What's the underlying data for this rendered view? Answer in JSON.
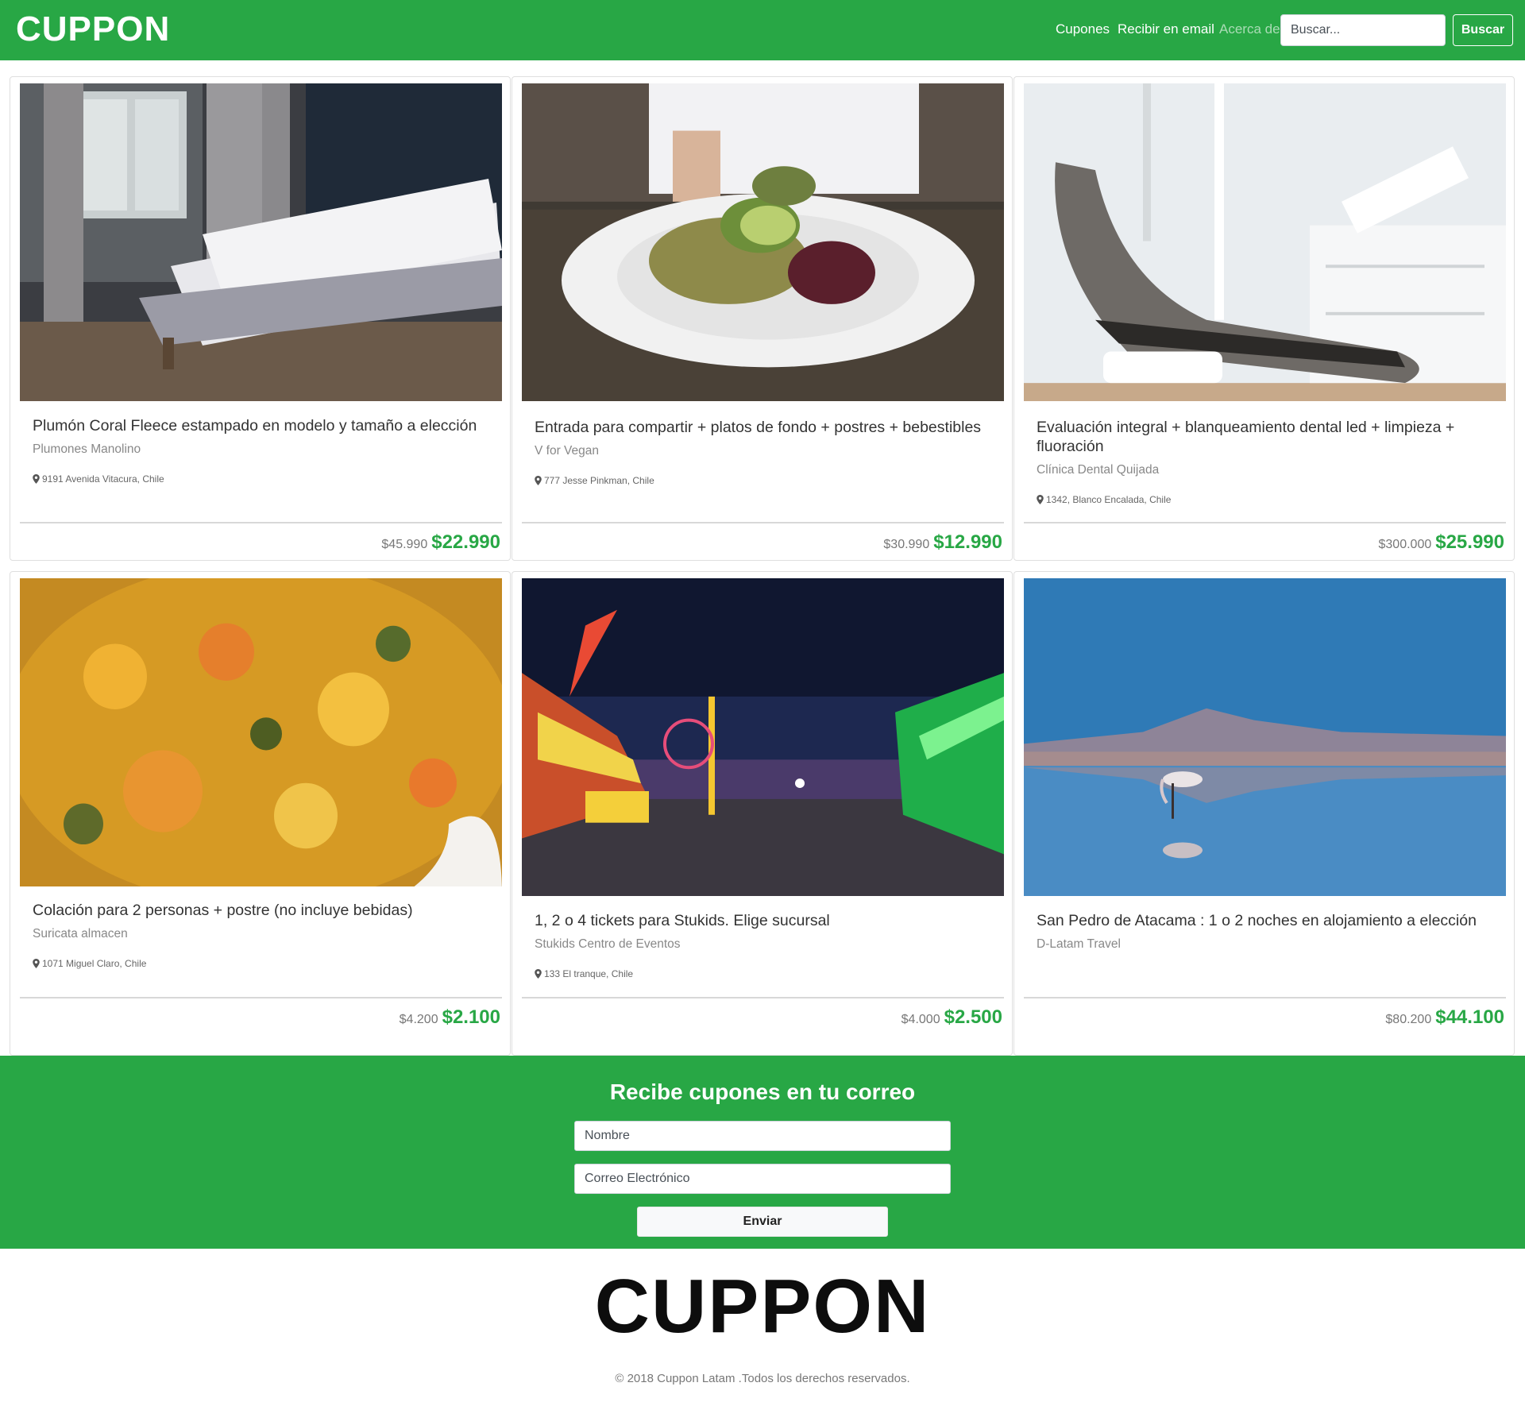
{
  "navbar": {
    "brand": "CUPPON",
    "links": [
      "Cupones",
      "Recibir en email",
      "Acerca de"
    ],
    "search_placeholder": "Buscar...",
    "search_button": "Buscar",
    "color": "#28a745"
  },
  "cards": [
    {
      "title": "Plumón Coral Fleece estampado en modelo y tamaño a elección",
      "vendor": "Plumones Manolino",
      "address": "9191 Avenida Vitacura, Chile",
      "price_old": "$45.990",
      "price_new": "$22.990",
      "image": "bedroom-photo"
    },
    {
      "title": "Entrada para compartir + platos de fondo + postres + bebestibles",
      "vendor": "V for Vegan",
      "address": "777 Jesse Pinkman, Chile",
      "price_old": "$30.990",
      "price_new": "$12.990",
      "image": "salad-plate-photo"
    },
    {
      "title": "Evaluación integral + blanqueamiento dental led + limpieza + fluoración",
      "vendor": "Clínica Dental Quijada",
      "address": "1342, Blanco Encalada, Chile",
      "price_old": "$300.000",
      "price_new": "$25.990",
      "image": "dental-chair-photo"
    },
    {
      "title": "Colación para 2 personas + postre (no incluye bebidas)",
      "vendor": "Suricata almacen",
      "address": "1071 Miguel Claro, Chile",
      "price_old": "$4.200",
      "price_new": "$2.100",
      "image": "rice-dish-photo"
    },
    {
      "title": "1, 2 o 4 tickets para Stukids. Elige sucursal",
      "vendor": "Stukids Centro de Eventos",
      "address": "133 El tranque, Chile",
      "price_old": "$4.000",
      "price_new": "$2.500",
      "image": "fairground-night-photo"
    },
    {
      "title": "San Pedro de Atacama : 1 o 2 noches en alojamiento a elección",
      "vendor": "D-Latam Travel",
      "address": "",
      "price_old": "$80.200",
      "price_new": "$44.100",
      "image": "flamingo-lake-photo"
    }
  ],
  "newsletter": {
    "title": "Recibe cupones en tu correo",
    "name_placeholder": "Nombre",
    "email_placeholder": "Correo Electrónico",
    "submit_label": "Enviar"
  },
  "footer": {
    "logo": "CUPPON",
    "copyright": "© 2018 Cuppon Latam .Todos los derechos reservados."
  }
}
